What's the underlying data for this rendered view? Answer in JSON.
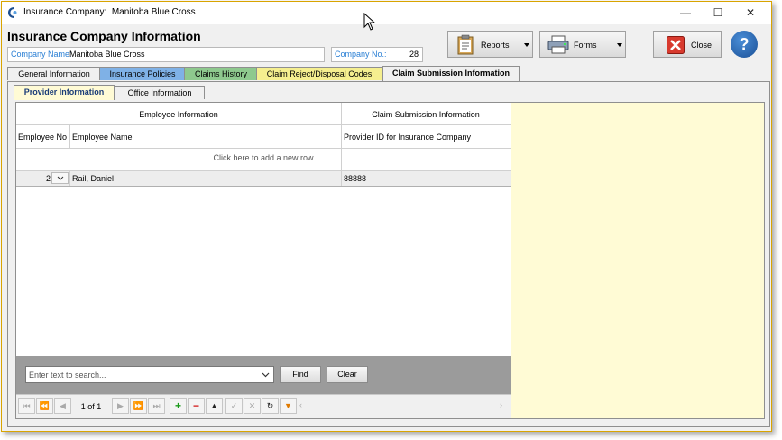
{
  "window": {
    "title_prefix": "Insurance Company:",
    "title_company": "Manitoba Blue Cross",
    "minimize": "—",
    "maximize": "☐",
    "close": "✕"
  },
  "header": {
    "title": "Insurance Company Information",
    "company_name_label": "Company Name:",
    "company_name_value": "Manitoba Blue Cross",
    "company_no_label": "Company No.:",
    "company_no_value": "28"
  },
  "toolbar": {
    "reports_label": "Reports",
    "forms_label": "Forms",
    "close_label": "Close",
    "help_label": "?"
  },
  "tabs": [
    {
      "label": "General Information",
      "color": "#f0f0f0"
    },
    {
      "label": "Insurance Policies",
      "color": "#7fb1e6"
    },
    {
      "label": "Claims History",
      "color": "#8ec98e"
    },
    {
      "label": "Claim Reject/Disposal Codes",
      "color": "#f5ef8f"
    },
    {
      "label": "Claim Submission Information",
      "color": "#f0f0f0"
    }
  ],
  "subtabs": [
    {
      "label": "Provider Information"
    },
    {
      "label": "Office Information"
    }
  ],
  "grid": {
    "band_employee": "Employee Information",
    "band_claim": "Claim Submission Information",
    "col_employee_no": "Employee No",
    "col_employee_name": "Employee Name",
    "col_provider_id": "Provider ID for Insurance Company",
    "add_row_text": "Click here to add a new row",
    "rows": [
      {
        "employee_no": "2",
        "employee_name": "Rail, Daniel",
        "provider_id": "88888"
      }
    ]
  },
  "search": {
    "placeholder": "Enter text to search...",
    "find_label": "Find",
    "clear_label": "Clear"
  },
  "navigator": {
    "page_text": "1 of 1"
  },
  "colors": {
    "accent_label": "#2a7fd4",
    "right_panel": "#fffbd5",
    "window_border": "#d9a400"
  }
}
